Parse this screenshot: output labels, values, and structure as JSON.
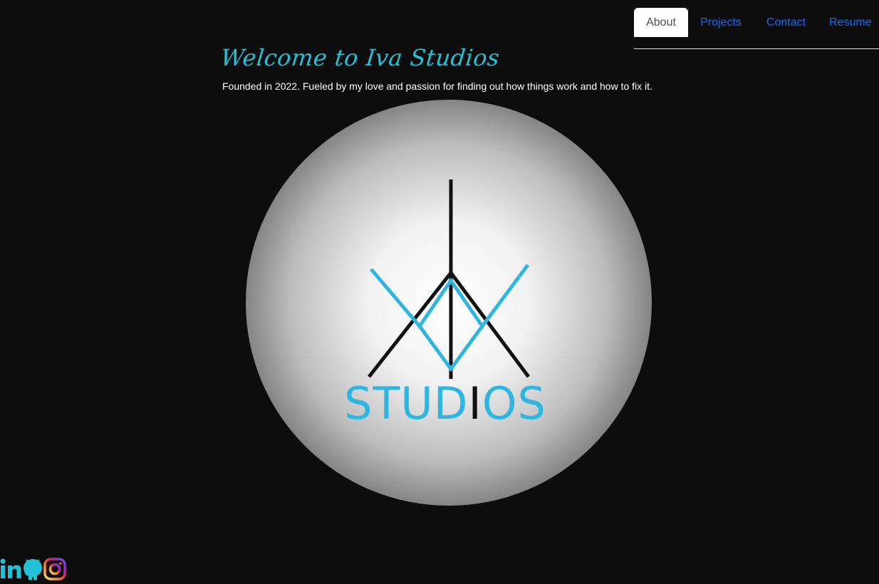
{
  "nav": {
    "tabs": [
      {
        "label": "About",
        "active": true
      },
      {
        "label": "Projects",
        "active": false
      },
      {
        "label": "Contact",
        "active": false
      },
      {
        "label": "Resume",
        "active": false
      }
    ]
  },
  "header": {
    "title": "Welcome to Iva Studios",
    "subtitle": "Founded in 2022. Fueled by my love and passion for finding out how things work and how to fix it."
  },
  "logo": {
    "studios_text": "STUDIOS"
  },
  "colors": {
    "accent": "#21c1d6",
    "logo_blue": "#2fb6e0",
    "link": "#0d6efd",
    "background": "#0d0d0d"
  },
  "social": {
    "icons": [
      "linkedin-icon",
      "github-icon",
      "instagram-icon"
    ]
  }
}
